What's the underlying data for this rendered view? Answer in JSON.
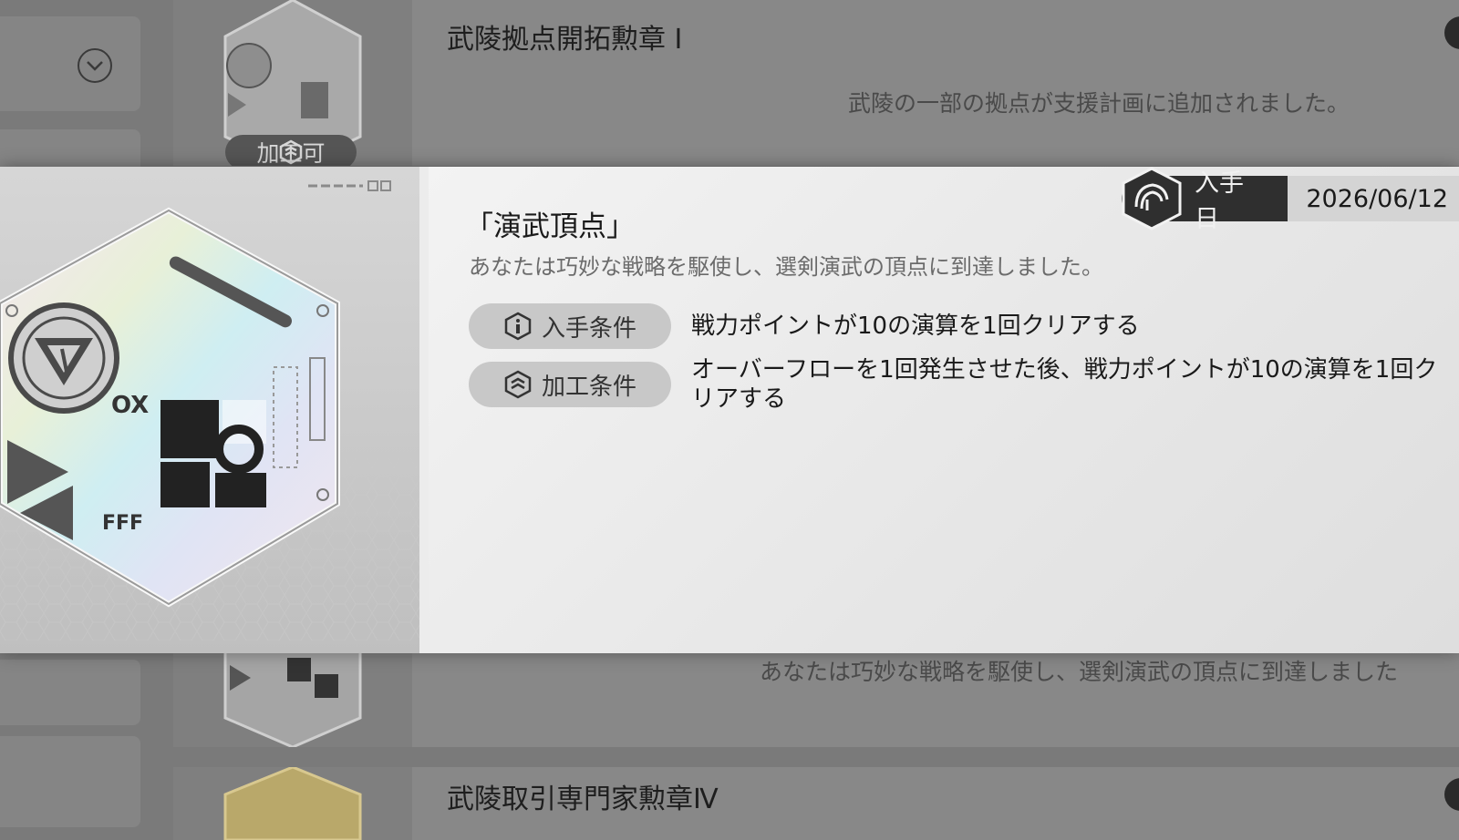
{
  "background_list": {
    "items": [
      {
        "title": "武陵拠点開拓勲章 I",
        "description": "武陵の一部の拠点が支援計画に追加されました。",
        "badge_label": "加工可"
      },
      {
        "title": "",
        "description": "あなたは巧妙な戦略を駆使し、選剣演武の頂点に到達しました"
      },
      {
        "title": "武陵取引専門家勲章Ⅳ",
        "description": ""
      }
    ]
  },
  "modal": {
    "title": "「演武頂点」",
    "description": "あなたは巧妙な戦略を駆使し、選剣演武の頂点に到達しました。",
    "acquired_label": "入手日",
    "acquired_date": "2026/06/12",
    "conditions": [
      {
        "label": "入手条件",
        "icon": "info-hex-icon",
        "text": "戦力ポイントが10の演算を1回クリアする"
      },
      {
        "label": "加工条件",
        "icon": "craft-hex-icon",
        "text": "オーバーフローを1回発生させた後、戦力ポイントが10の演算を1回クリアする"
      }
    ],
    "medal_text": {
      "ox": "OX",
      "fff": "FFF"
    }
  },
  "colors": {
    "modal_bg": "#ececec",
    "dim_bg": "#7a7a7a",
    "label_dark": "#2f2f2f"
  }
}
